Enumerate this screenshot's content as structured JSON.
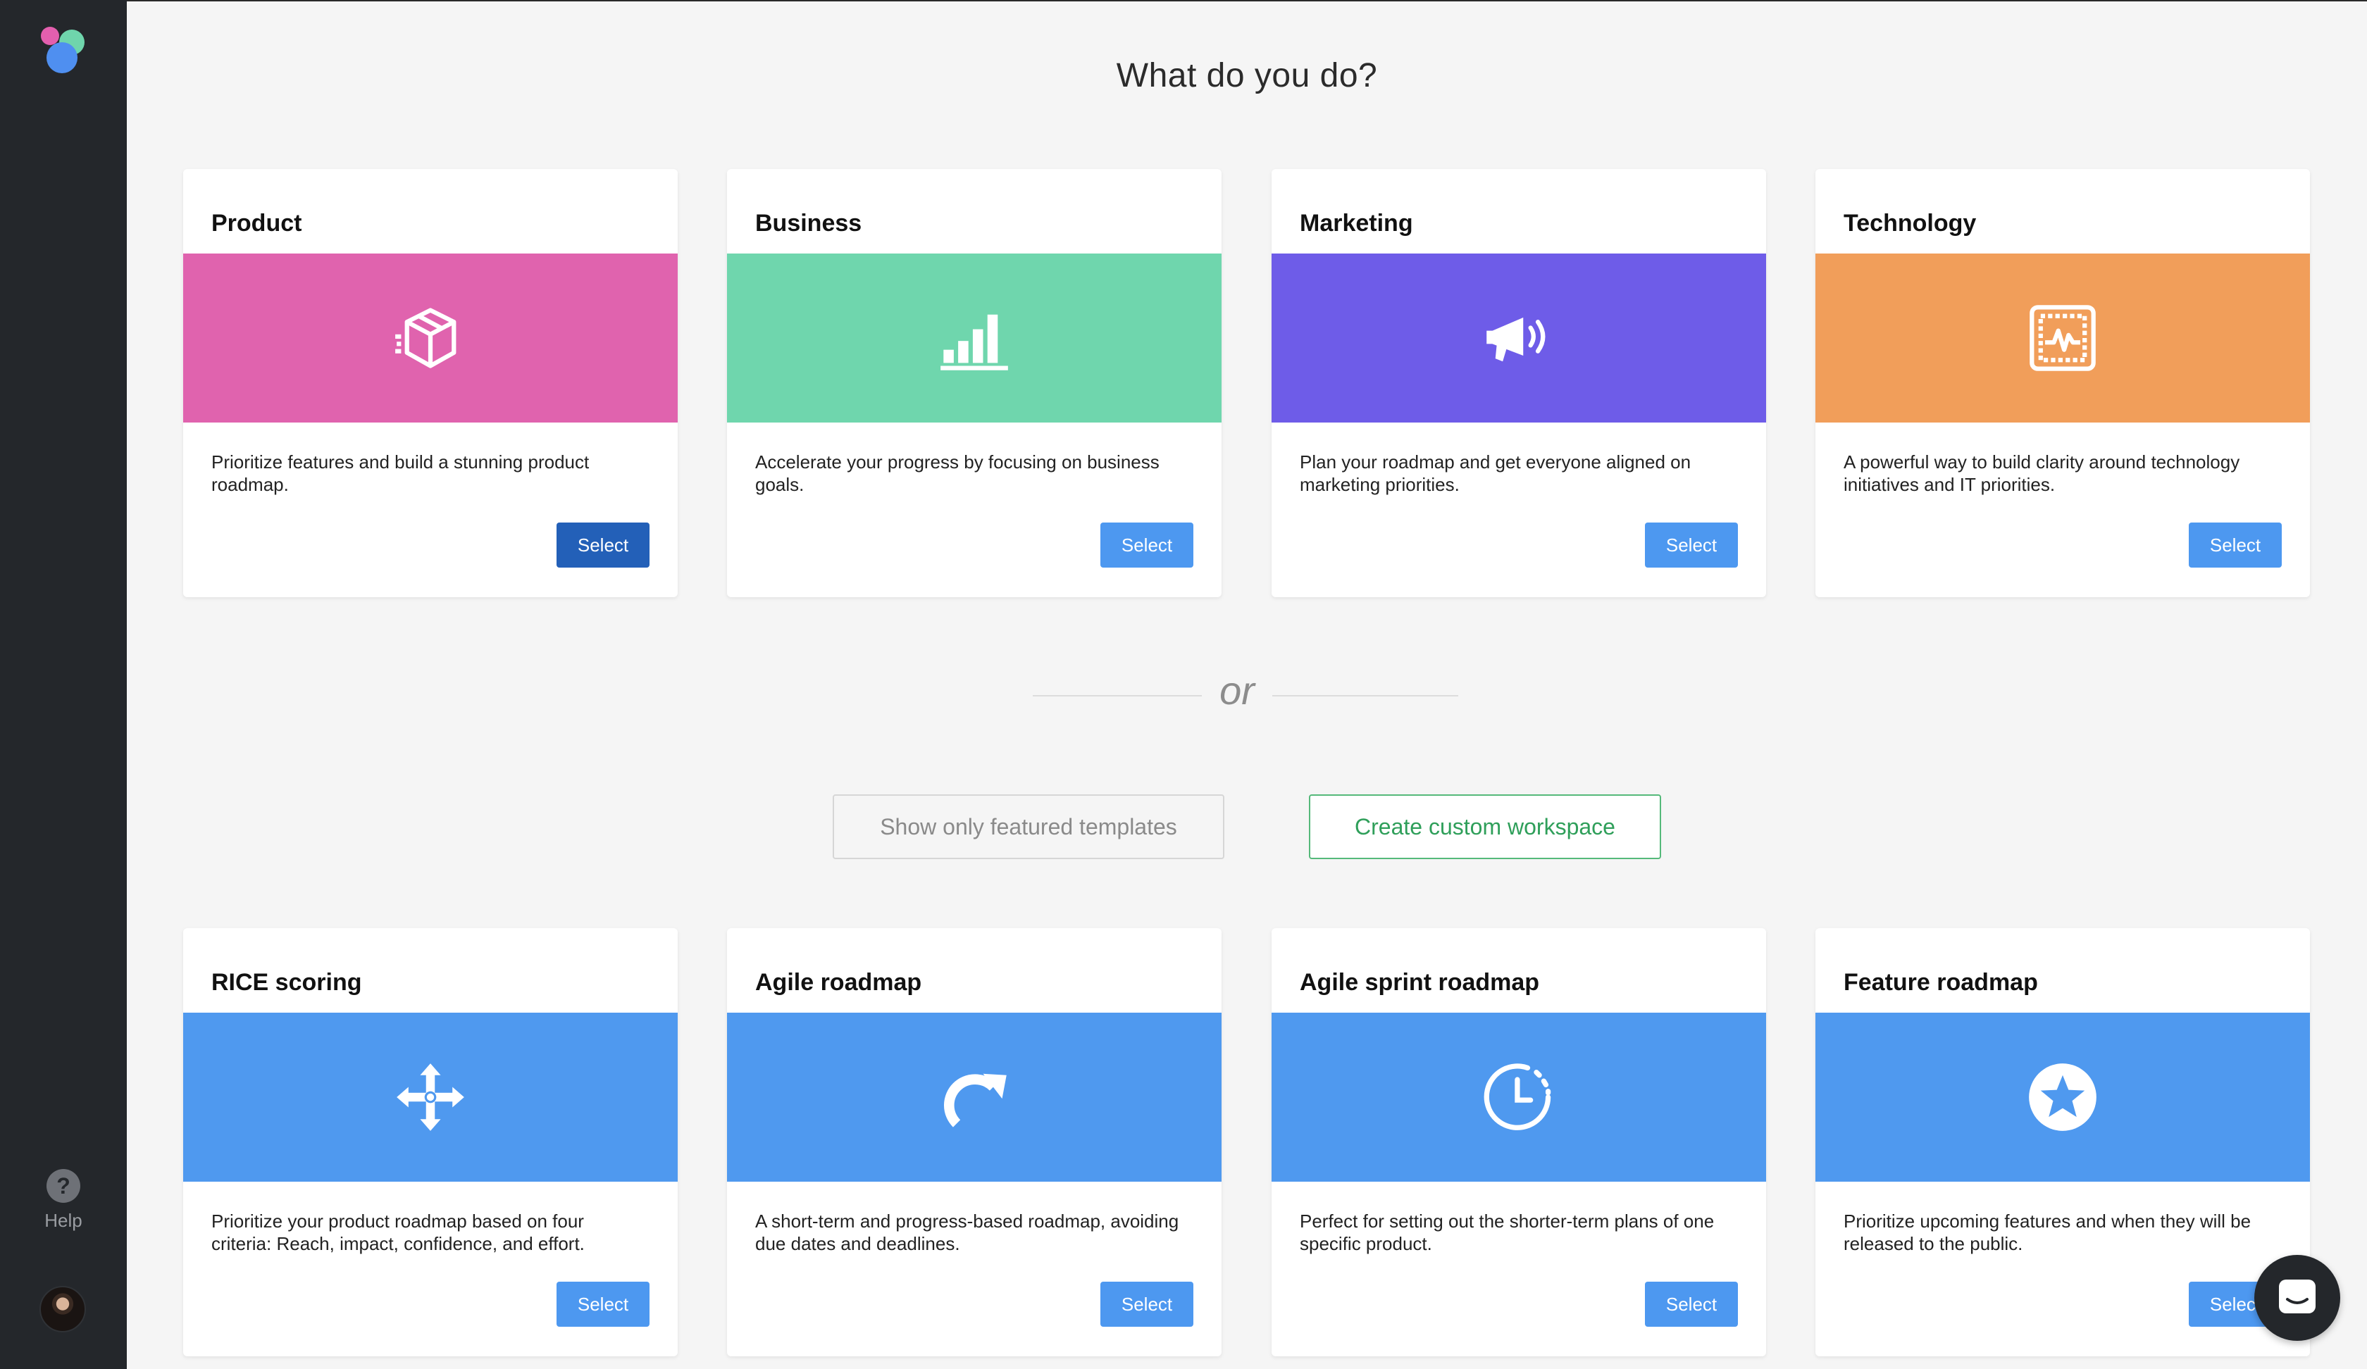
{
  "page": {
    "title": "What do you do?"
  },
  "sidebar": {
    "help_label": "Help",
    "help_glyph": "?"
  },
  "categories": [
    {
      "title": "Product",
      "description": "Prioritize features and build a stunning product roadmap.",
      "button": "Select",
      "color": "#e063ae",
      "icon": "package-icon"
    },
    {
      "title": "Business",
      "description": "Accelerate your progress by focusing on business goals.",
      "button": "Select",
      "color": "#6fd6ad",
      "icon": "bar-chart-icon"
    },
    {
      "title": "Marketing",
      "description": "Plan your roadmap and get everyone aligned on marketing priorities.",
      "button": "Select",
      "color": "#6e5ce8",
      "icon": "megaphone-icon"
    },
    {
      "title": "Technology",
      "description": "A powerful way to build clarity around technology initiatives and IT priorities.",
      "button": "Select",
      "color": "#f19e5a",
      "icon": "monitor-pulse-icon"
    }
  ],
  "divider": {
    "text": "or"
  },
  "actions": {
    "featured_label": "Show only featured templates",
    "custom_label": "Create custom workspace"
  },
  "templates": [
    {
      "title": "RICE scoring",
      "description": "Prioritize your product roadmap based on four criteria: Reach, impact, confidence, and effort.",
      "button": "Select",
      "color": "#4f99ef",
      "icon": "move-arrows-icon"
    },
    {
      "title": "Agile roadmap",
      "description": "A short-term and progress-based roadmap, avoiding due dates and deadlines.",
      "button": "Select",
      "color": "#4f99ef",
      "icon": "redo-arrow-icon"
    },
    {
      "title": "Agile sprint roadmap",
      "description": "Perfect for setting out the shorter-term plans of one specific product.",
      "button": "Select",
      "color": "#4f99ef",
      "icon": "clock-history-icon"
    },
    {
      "title": "Feature roadmap",
      "description": "Prioritize upcoming features and when they will be released to the public.",
      "button": "Select",
      "color": "#4f99ef",
      "icon": "star-circle-icon"
    }
  ]
}
